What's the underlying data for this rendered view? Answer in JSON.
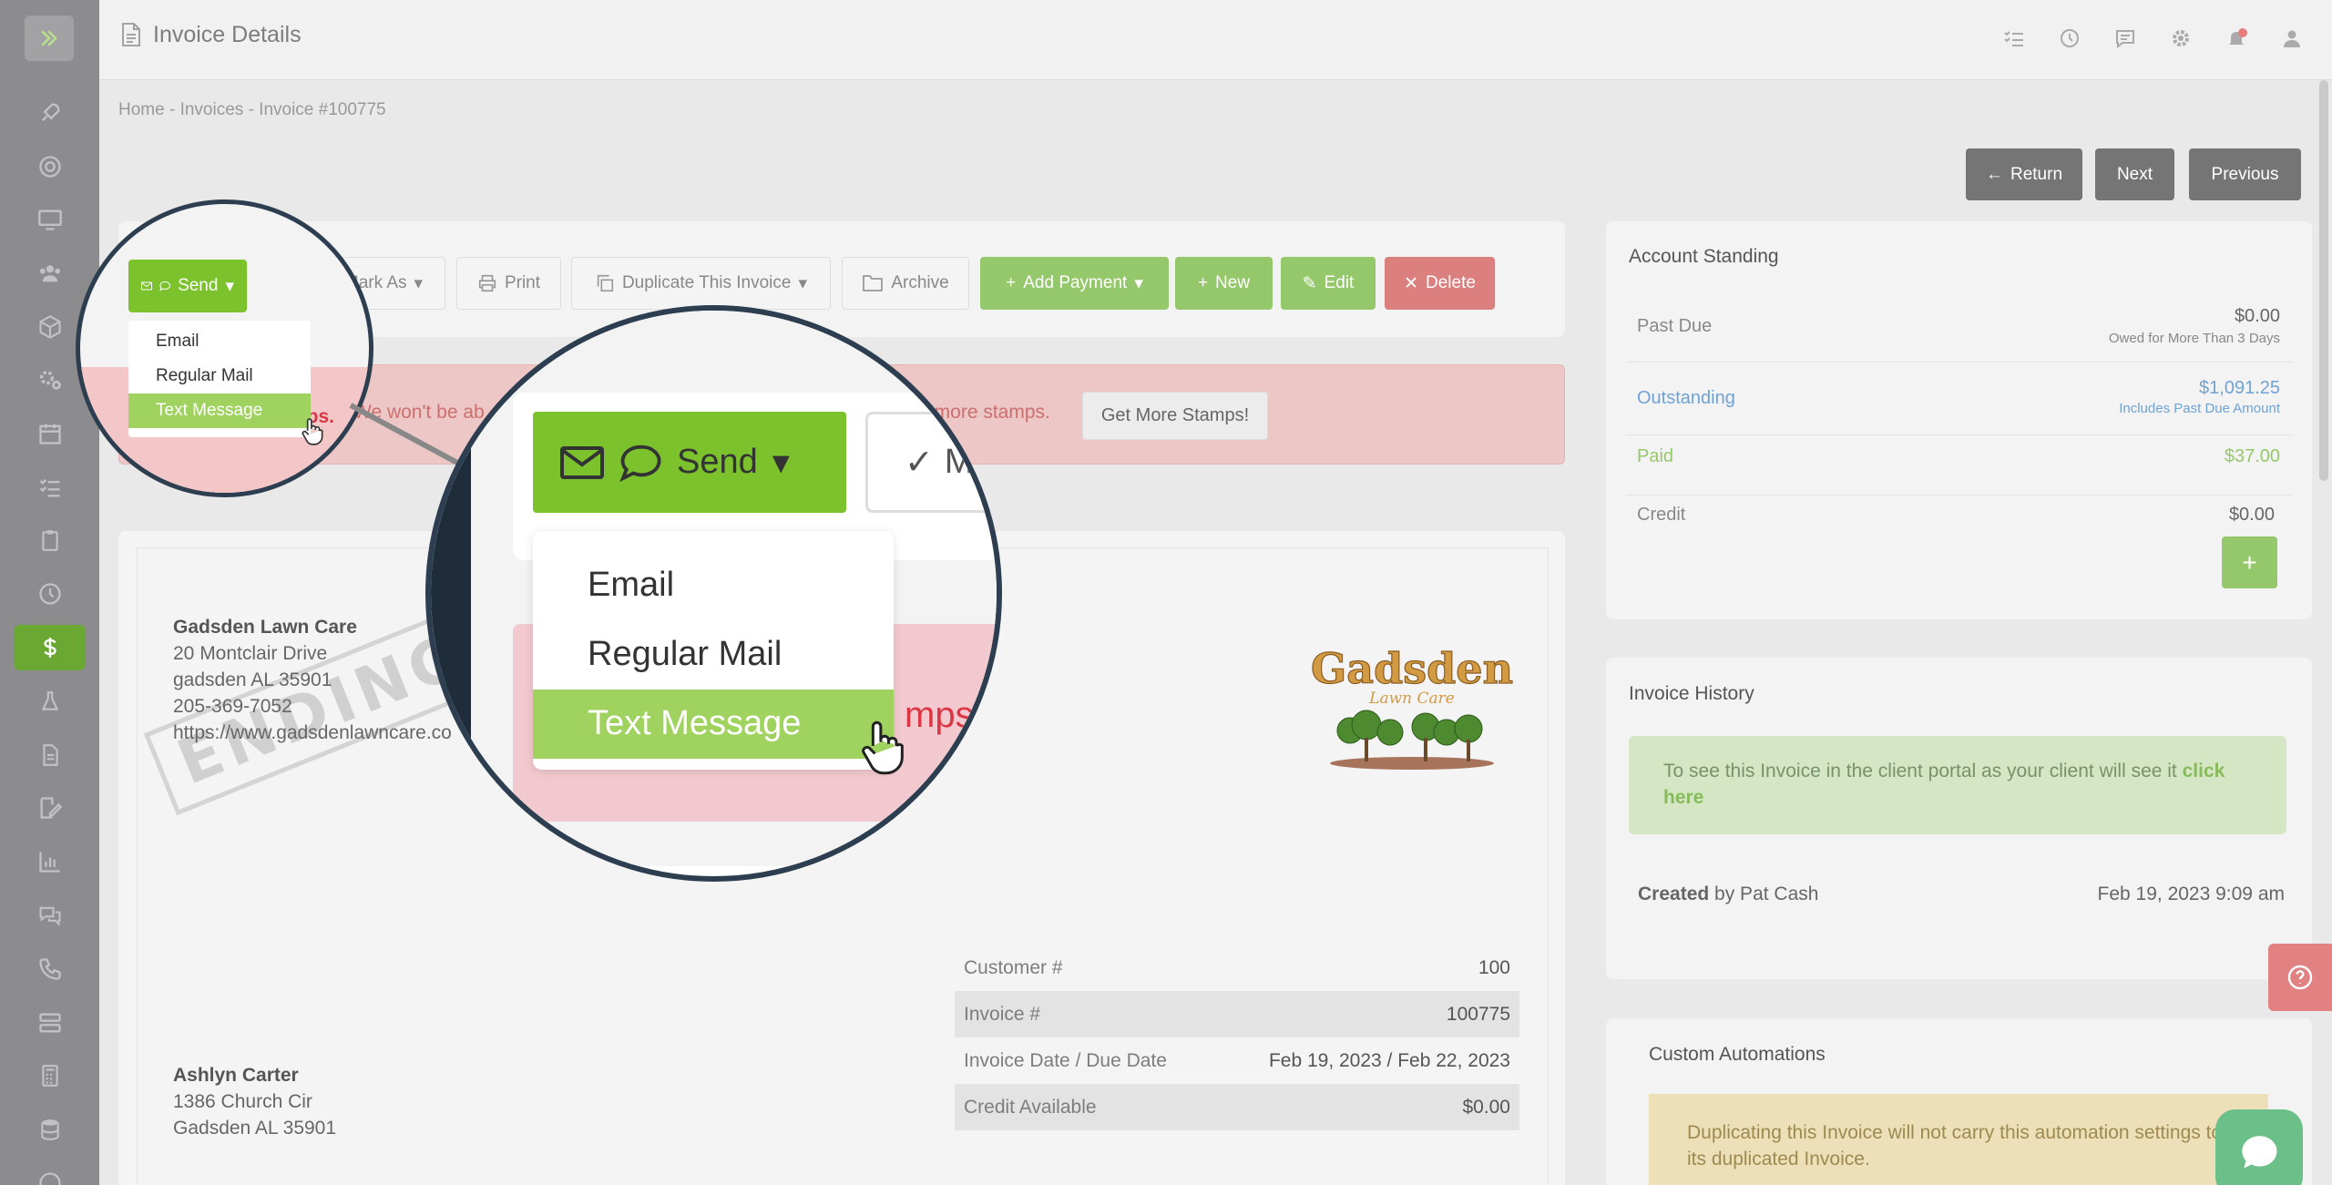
{
  "header": {
    "title": "Invoice Details",
    "icons": [
      "checklist-icon",
      "clock-icon",
      "chat-icon",
      "gear-icon",
      "bell-icon",
      "user-icon"
    ]
  },
  "sidebar": {
    "toggle_icon": "double-chevron-right-icon",
    "items": [
      "rocket-icon",
      "lifebuoy-icon",
      "monitor-icon",
      "users-icon",
      "box-icon",
      "cogs-icon",
      "calendar-icon",
      "tasks-icon",
      "clipboard-icon",
      "clock-icon",
      "dollar-icon",
      "flask-icon",
      "document-icon",
      "signature-icon",
      "bar-chart-icon",
      "comments-icon",
      "phone-icon",
      "server-icon",
      "calculator-icon",
      "database-icon"
    ],
    "active": "dollar-icon"
  },
  "breadcrumb": {
    "home": "Home",
    "sep": "-",
    "invoices": "Invoices",
    "current": "Invoice #100775"
  },
  "nav_buttons": {
    "return": "Return",
    "next": "Next",
    "previous": "Previous"
  },
  "toolbar": {
    "send": "Send",
    "mark_as": "Mark As",
    "print": "Print",
    "duplicate": "Duplicate This Invoice",
    "archive": "Archive",
    "add_payment": "Add Payment",
    "new": "New",
    "edit": "Edit",
    "delete": "Delete"
  },
  "send_menu": {
    "items": [
      "Email",
      "Regular Mail",
      "Text Message"
    ],
    "selected": "Text Message"
  },
  "alert": {
    "small_prefix": "mps.",
    "text_visible": "We won't be ab",
    "text_tail": "t more stamps.",
    "zoom_tail": "mps.",
    "button": "Get More Stamps!"
  },
  "zoom_partial_button": "M",
  "company": {
    "name": "Gadsden Lawn Care",
    "address1": "20 Montclair Drive",
    "address2": "gadsden AL 35901",
    "phone": "205-369-7052",
    "website": "https://www.gadsdenlawncare.co"
  },
  "stamp": "ENDING",
  "logo": {
    "line1": "Gadsden",
    "line2": "Lawn Care"
  },
  "client": {
    "name": "Ashlyn Carter",
    "address1": "1386 Church Cir",
    "address2": "Gadsden AL 35901"
  },
  "invoice_meta": {
    "customer_label": "Customer #",
    "customer_value": "100",
    "invoice_label": "Invoice #",
    "invoice_value": "100775",
    "date_label": "Invoice Date / Due Date",
    "date_value": "Feb 19, 2023 / Feb 22, 2023",
    "credit_label": "Credit Available",
    "credit_value": "$0.00"
  },
  "account_standing": {
    "title": "Account Standing",
    "past_due_label": "Past Due",
    "past_due_value": "$0.00",
    "past_due_sub": "Owed for More Than 3 Days",
    "outstanding_label": "Outstanding",
    "outstanding_value": "$1,091.25",
    "outstanding_sub": "Includes Past Due Amount",
    "paid_label": "Paid",
    "paid_value": "$37.00",
    "credit_label": "Credit",
    "credit_value": "$0.00",
    "add_button": "+"
  },
  "invoice_history": {
    "title": "Invoice History",
    "portal_text": "To see this Invoice in the client portal as your client will see it",
    "portal_link": "click here",
    "created_label": "Created",
    "created_by": "by Pat Cash",
    "created_date": "Feb 19, 2023 9:09 am"
  },
  "custom_automations": {
    "title": "Custom Automations",
    "notice": "Duplicating this Invoice will not carry this automation settings to its duplicated Invoice."
  },
  "colors": {
    "brand_green": "#7bc22d",
    "danger": "#dc3545",
    "sidebar": "#8c8c8f"
  }
}
